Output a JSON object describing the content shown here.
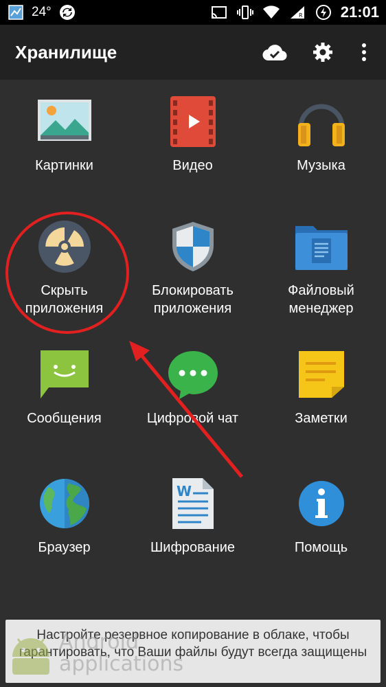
{
  "status_bar": {
    "temperature": "24°",
    "time": "21:01"
  },
  "toolbar": {
    "title": "Хранилище"
  },
  "tiles": [
    {
      "label": "Картинки"
    },
    {
      "label": "Видео"
    },
    {
      "label": "Музыка"
    },
    {
      "label": "Скрыть приложения"
    },
    {
      "label": "Блокировать приложения"
    },
    {
      "label": "Файловый менеджер"
    },
    {
      "label": "Сообщения"
    },
    {
      "label": "Цифровой чат"
    },
    {
      "label": "Заметки"
    },
    {
      "label": "Браузер"
    },
    {
      "label": "Шифрование"
    },
    {
      "label": "Помощь"
    }
  ],
  "banner": {
    "text": "Настройте резервное копирование в облаке, чтобы гарантировать, что Ваши файлы будут всегда защищены"
  },
  "watermark": {
    "line1": "Android",
    "line2": "applications"
  },
  "colors": {
    "annotation_red": "#e32020",
    "toolbar_bg": "#222222",
    "screen_bg": "#2f2f2f"
  }
}
